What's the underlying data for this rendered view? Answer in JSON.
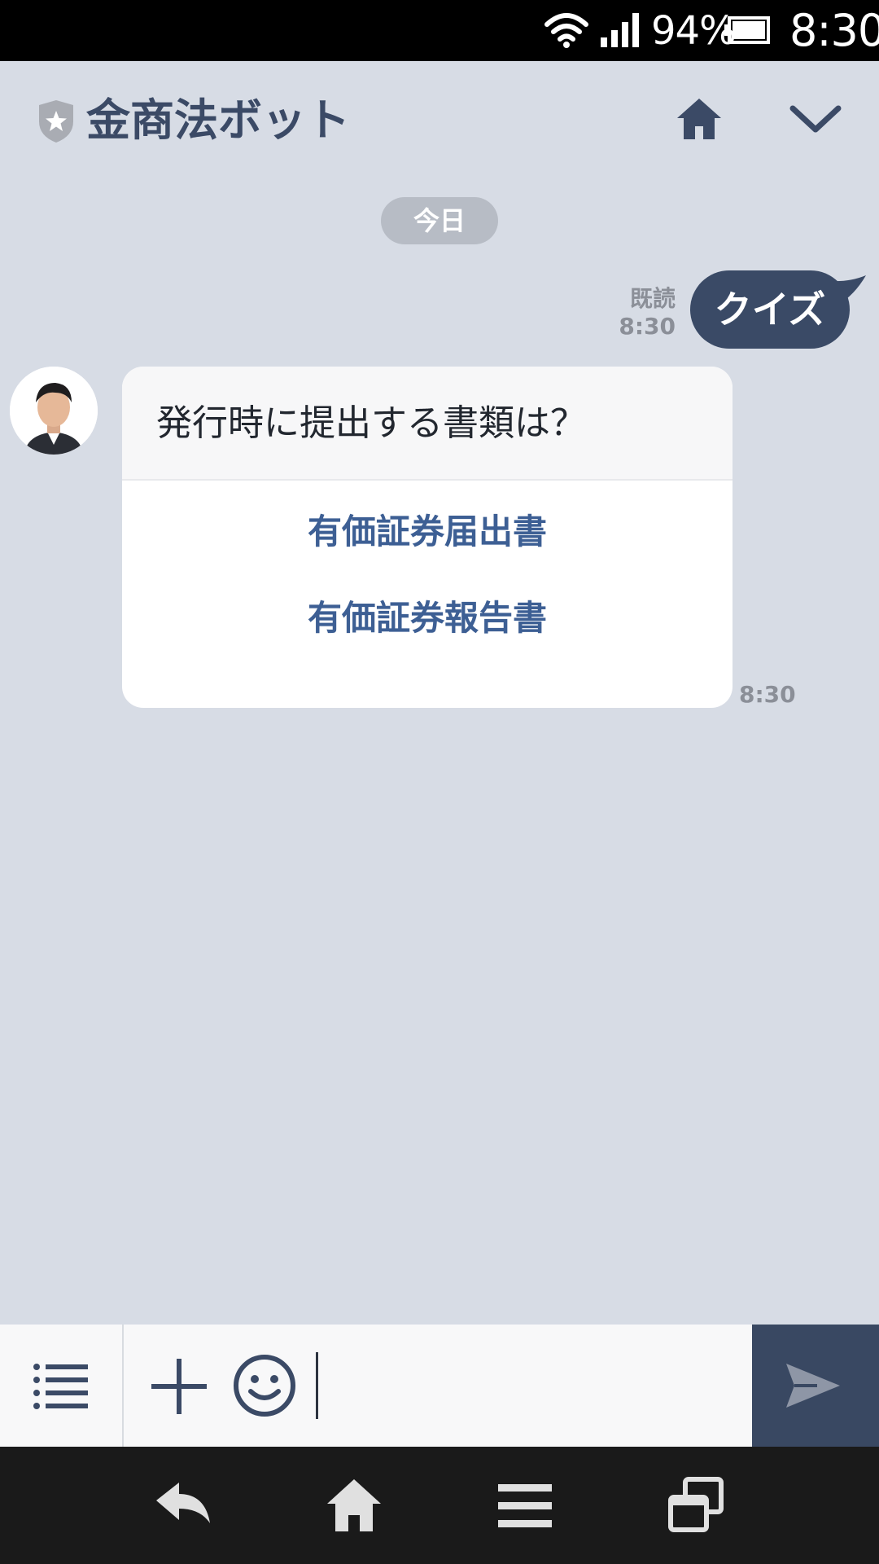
{
  "status_bar": {
    "battery_percent": "94%",
    "time": "8:30"
  },
  "header": {
    "title": "金商法ボット"
  },
  "date_label": "今日",
  "sent_message": {
    "text": "クイズ",
    "read_label": "既読",
    "time": "8:30"
  },
  "bot_message": {
    "question": "発行時に提出する書類は？",
    "options": [
      "有価証券届出書",
      "有価証券報告書"
    ],
    "time": "8:30"
  },
  "input": {
    "value": "",
    "placeholder": ""
  },
  "icons": {
    "header": [
      "shield-star-icon",
      "home-icon",
      "chevron-down-icon"
    ],
    "input_bar": [
      "menu-list-icon",
      "plus-icon",
      "smile-icon",
      "send-icon"
    ],
    "nav_bar": [
      "back-icon",
      "home-icon",
      "menu-icon",
      "recents-icon"
    ]
  },
  "colors": {
    "background": "#d7dce5",
    "header_text": "#3b4a66",
    "sent_bubble": "#3a4a66",
    "option_link": "#3d5f94",
    "send_button": "#394862"
  }
}
